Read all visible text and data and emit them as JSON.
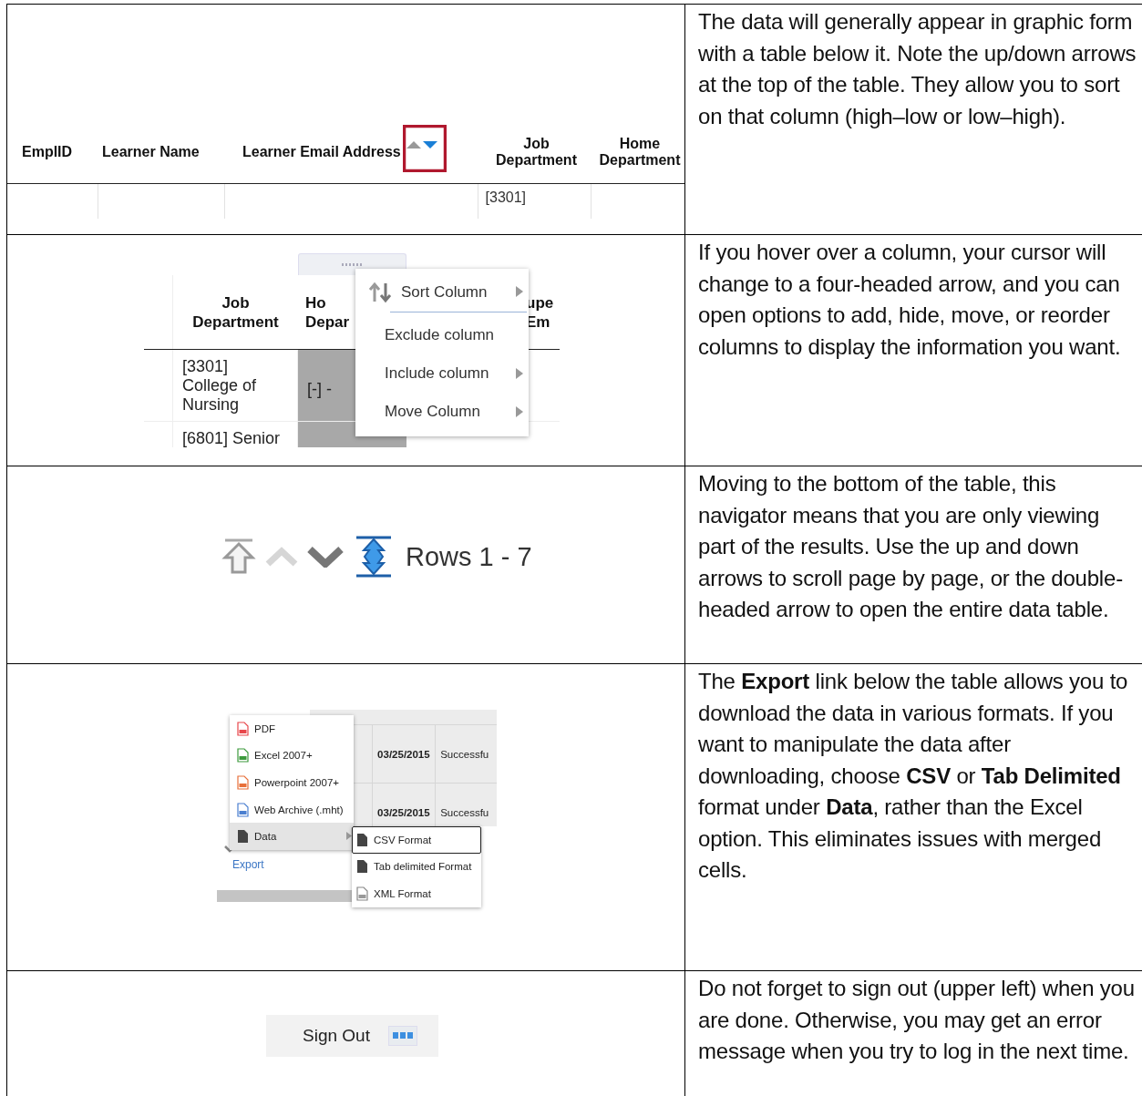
{
  "rows": [
    {
      "kind": "sort_headers",
      "figure": {
        "headers": [
          {
            "label": "EmplID",
            "sort_arrows": false
          },
          {
            "label": "Learner Name",
            "sort_arrows": false
          },
          {
            "label": "Learner Email Address",
            "sort_arrows": true
          },
          {
            "label": "Job Department",
            "sort_arrows": false
          },
          {
            "label": "Home Department",
            "sort_arrows": false
          }
        ],
        "visible_cell": "[3301]"
      },
      "text": "The data will generally appear in graphic form with a table below it. Note the up/down arrows at the top of the table. They allow you to sort on that column (high–low or low–high)."
    },
    {
      "kind": "column_menu",
      "figure": {
        "headers": [
          "Job Department",
          "Ho Depar",
          "upe Em"
        ],
        "cells": [
          "[3301] College of Nursing",
          "[-] -",
          "[6801] Senior"
        ],
        "menu": [
          {
            "label": "Sort Column",
            "kind": "sort",
            "submenu": true
          },
          {
            "label": "Exclude column",
            "kind": "plain",
            "submenu": false
          },
          {
            "label": "Include column",
            "kind": "plain",
            "submenu": true
          },
          {
            "label": "Move Column",
            "kind": "plain",
            "submenu": true
          }
        ]
      },
      "text": "If you hover over a column, your cursor will change to a four-headed arrow, and you can open options to add, hide, move, or reorder columns to display the information you want."
    },
    {
      "kind": "navigator",
      "figure": {
        "label": "Rows 1 - 7"
      },
      "text": "Moving to the bottom of the table, this navigator means that you are only viewing part of the results. Use the up and down arrows to scroll page by page, or the double-headed arrow to open the entire data table."
    },
    {
      "kind": "export_menu",
      "figure": {
        "table_rows": [
          [
            "03/25/2015",
            "Successfu"
          ],
          [
            "03/25/2015",
            "Successfu"
          ]
        ],
        "menu": [
          {
            "label": "PDF",
            "kind": "file",
            "color": "#e8474b",
            "selected": false,
            "submenu": false
          },
          {
            "label": "Excel 2007+",
            "kind": "file",
            "color": "#3c9a3c",
            "selected": false,
            "submenu": false
          },
          {
            "label": "Powerpoint 2007+",
            "kind": "file",
            "color": "#e8703a",
            "selected": false,
            "submenu": false
          },
          {
            "label": "Web Archive (.mht)",
            "kind": "file",
            "color": "#4a7fd0",
            "selected": false,
            "submenu": false
          },
          {
            "label": "Data",
            "kind": "doc",
            "color": "#444444",
            "selected": true,
            "submenu": true
          }
        ],
        "submenu": [
          {
            "label": "CSV Format",
            "kind": "doc",
            "selected": true
          },
          {
            "label": "Tab delimited Format",
            "kind": "doc",
            "selected": false
          },
          {
            "label": "XML Format",
            "kind": "file",
            "selected": false
          }
        ],
        "link": "Export"
      },
      "text": "The **Export** link below the table allows you to download the data in various formats. If you want to manipulate the data after downloading, choose **CSV** or **Tab Delimited** format under **Data**, rather than the Excel option. This eliminates issues with merged cells."
    },
    {
      "kind": "sign_out",
      "figure": {
        "label": "Sign Out"
      },
      "text": "Do not forget to sign out (upper left) when you are done. Otherwise, you may get an error message when you try to log in the next time."
    }
  ]
}
